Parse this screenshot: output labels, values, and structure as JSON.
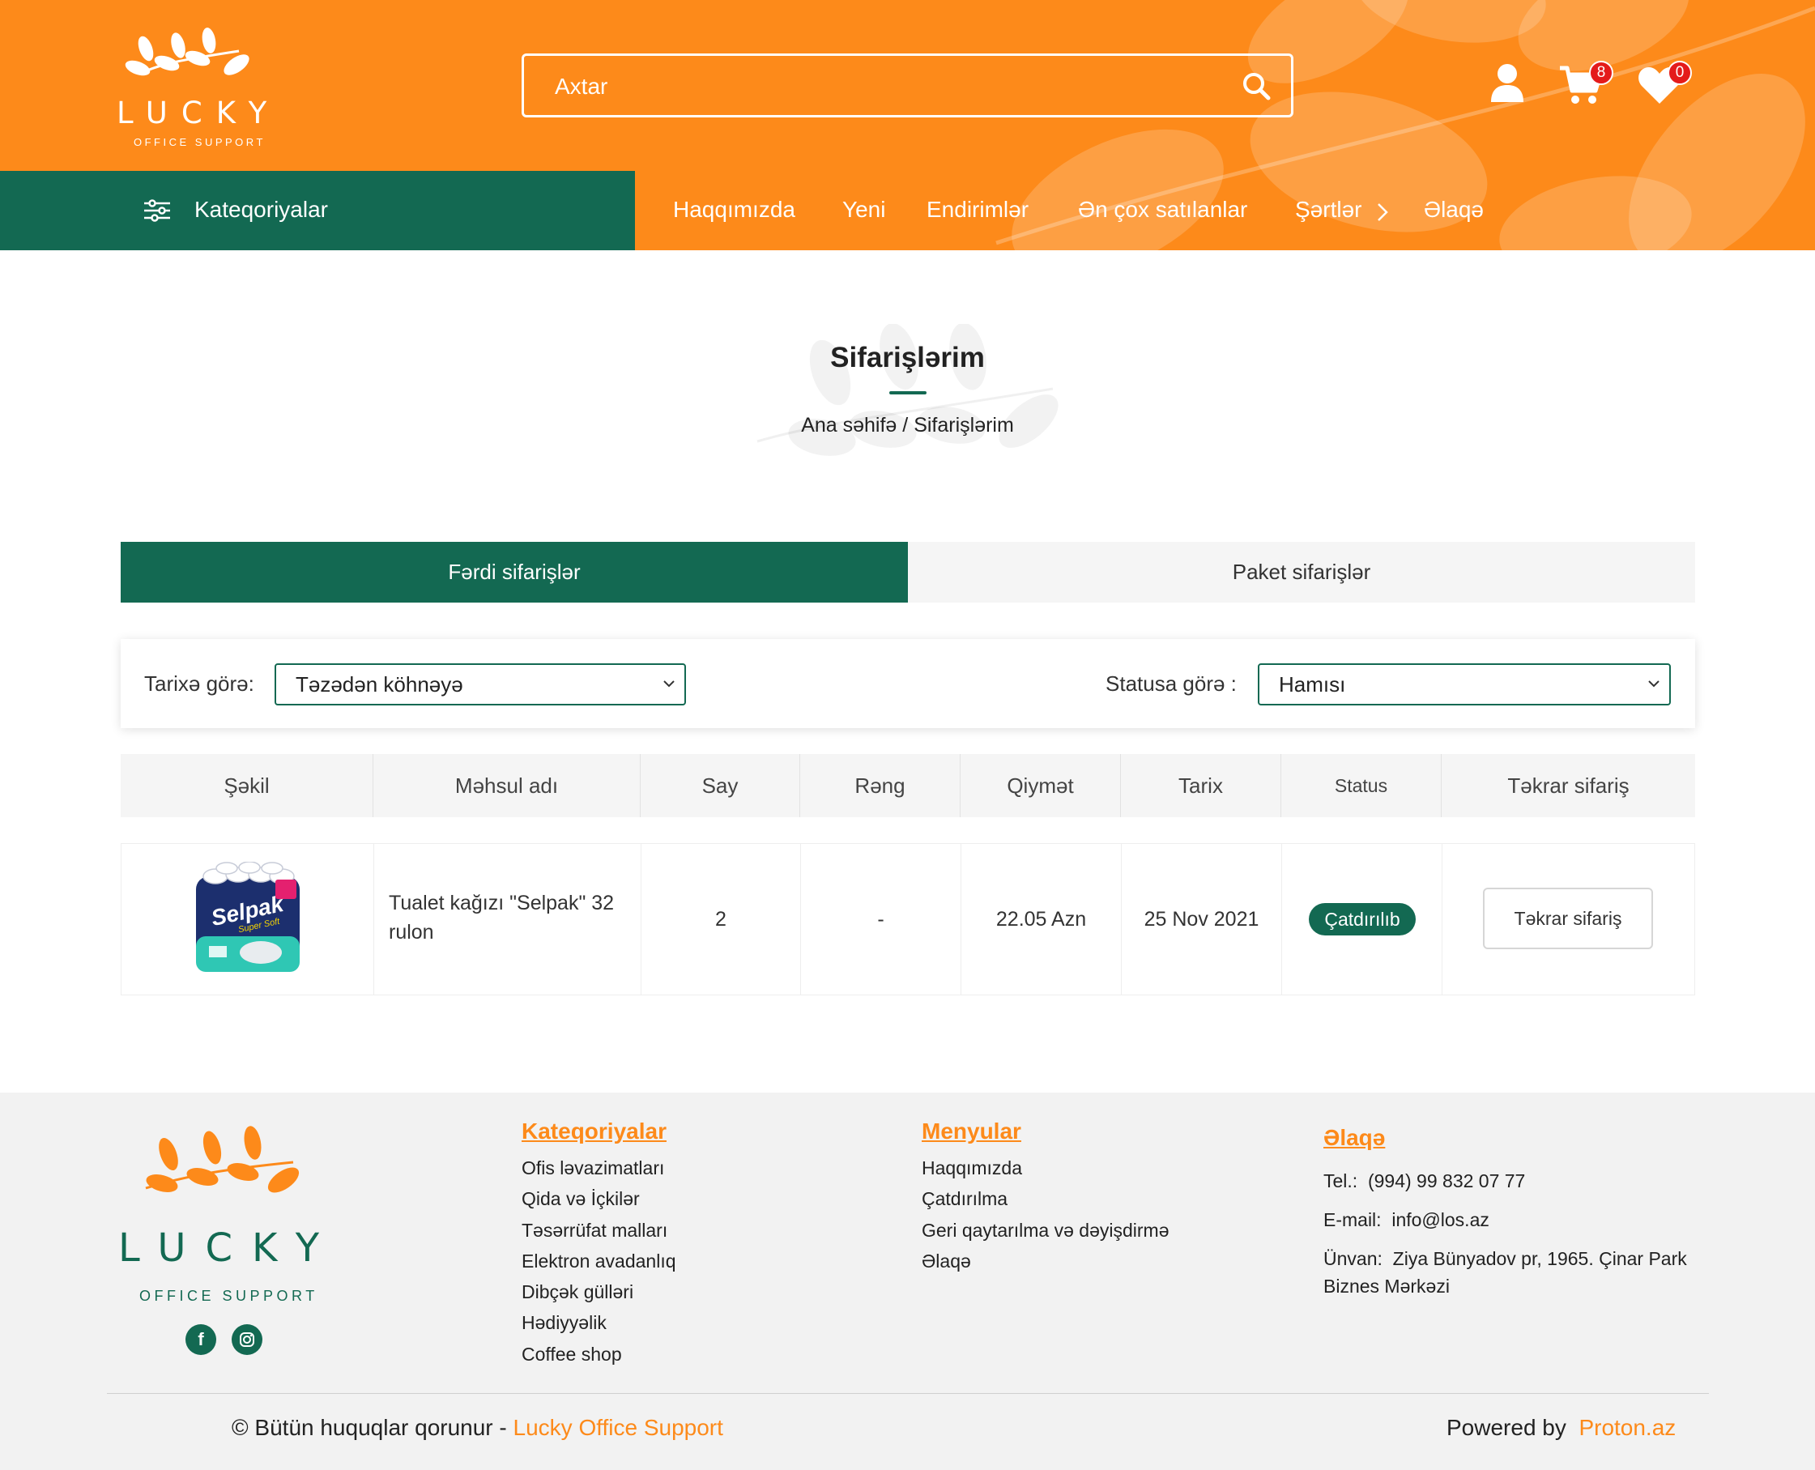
{
  "header": {
    "brand": {
      "name": "LUCKY",
      "tagline": "OFFICE SUPPORT"
    },
    "search": {
      "placeholder": "Axtar"
    },
    "icons": {
      "user": "user-icon",
      "cart": "cart-icon",
      "wishlist": "heart-icon"
    },
    "cart_count": "8",
    "wishlist_count": "0"
  },
  "navbar": {
    "categories_label": "Kateqoriyalar",
    "items": [
      {
        "label": "Haqqımızda"
      },
      {
        "label": "Yeni"
      },
      {
        "label": "Endirimlər"
      },
      {
        "label": "Ən çox satılanlar"
      },
      {
        "label": "Şərtlər"
      },
      {
        "label": "Əlaqə"
      }
    ]
  },
  "page": {
    "title": "Sifarişlərim",
    "breadcrumb": {
      "home": "Ana səhifə",
      "separator": "/",
      "current": "Sifarişlərim"
    }
  },
  "tabs": [
    {
      "label": "Fərdi sifarişlər",
      "active": true
    },
    {
      "label": "Paket sifarişlər",
      "active": false
    }
  ],
  "filters": {
    "date_label": "Tarixə görə:",
    "date_value": "Təzədən köhnəyə",
    "status_label": "Statusa görə :",
    "status_value": "Hamısı"
  },
  "table": {
    "columns": [
      "Şəkil",
      "Məhsul adı",
      "Say",
      "Rəng",
      "Qiymət",
      "Tarix",
      "Status",
      "Təkrar sifariş"
    ],
    "rows": [
      {
        "image_label": "Selpak",
        "image_sub": "Super Soft",
        "product": "Tualet kağızı \"Selpak\" 32 rulon",
        "qty": "2",
        "color": "-",
        "price": "22.05 Azn",
        "date": "25 Nov 2021",
        "status": "Çatdırılıb",
        "reorder": "Təkrar sifariş"
      }
    ]
  },
  "footer": {
    "brand": {
      "name": "LUCKY",
      "tagline": "OFFICE SUPPORT"
    },
    "categories": {
      "heading": "Kateqoriyalar",
      "items": [
        "Ofis ləvazimatları",
        "Qida və İçkilər",
        "Təsərrüfat malları",
        "Elektron avadanlıq",
        "Dibçək gülləri",
        "Hədiyyəlik",
        "Coffee shop"
      ]
    },
    "menus": {
      "heading": "Menyular",
      "items": [
        "Haqqımızda",
        "Çatdırılma",
        "Geri qaytarılma və dəyişdirmə",
        "Əlaqə"
      ]
    },
    "contact": {
      "heading": "Əlaqə",
      "tel_label": "Tel.:",
      "tel": "(994) 99 832 07 77",
      "email_label": "E-mail:",
      "email": "info@los.az",
      "address_label": "Ünvan:",
      "address": "Ziya Bünyadov pr, 1965. Çinar Park Biznes Mərkəzi"
    },
    "copyright_text": "© Bütün huquqlar qorunur -",
    "copyright_brand": "Lucky Office Support",
    "powered_text": "Powered by",
    "powered_brand": "Proton.az"
  },
  "colors": {
    "brand_orange": "#fd8a1a",
    "brand_green": "#136952",
    "badge_red": "#e41b1b"
  }
}
